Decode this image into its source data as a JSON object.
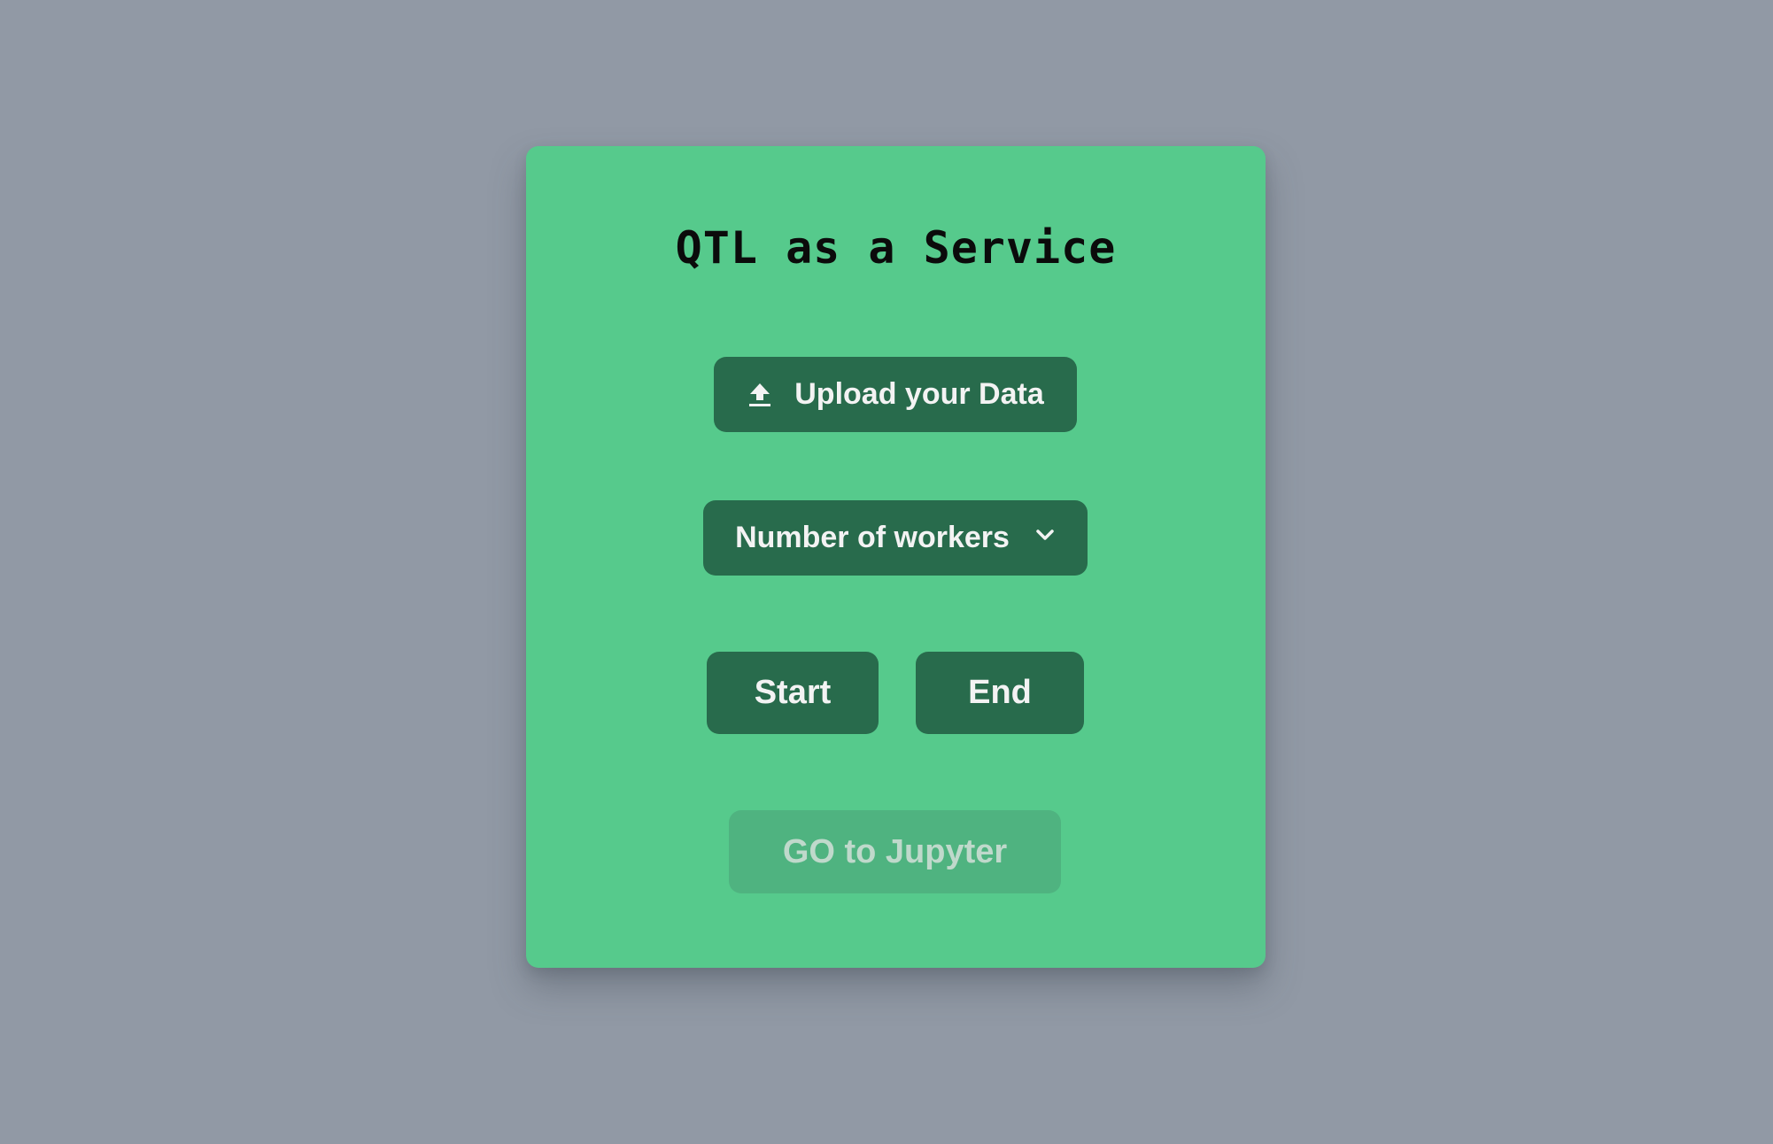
{
  "app": {
    "title": "QTL as a Service"
  },
  "actions": {
    "upload_label": "Upload your Data",
    "upload_icon": "upload-icon",
    "workers_label": "Number of workers",
    "workers_icon": "chevron-down-icon",
    "start_label": "Start",
    "end_label": "End",
    "jupyter_label": "GO to Jupyter",
    "jupyter_disabled": true
  },
  "colors": {
    "background": "#9199a5",
    "card": "#56ca8c",
    "button": "#286b4c",
    "button_text": "#f3f3f3",
    "disabled_button": "#4fb380",
    "disabled_text": "#bfd9cb"
  }
}
